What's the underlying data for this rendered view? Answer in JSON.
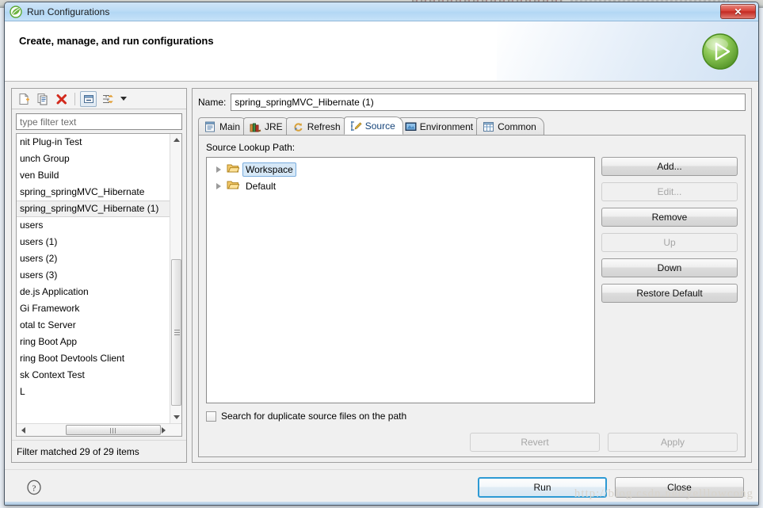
{
  "window": {
    "title": "Run Configurations",
    "title_icon": "spring-leaf-icon",
    "close_label": "✕"
  },
  "header": {
    "title": "Create, manage, and run configurations",
    "badge_icon": "run-play-icon"
  },
  "left_panel": {
    "toolbar": [
      {
        "name": "new-launch-configuration-icon",
        "label": "New launch configuration"
      },
      {
        "name": "duplicate-launch-configuration-icon",
        "label": "Duplicate"
      },
      {
        "name": "delete-launch-configuration-icon",
        "label": "Delete"
      },
      {
        "name": "collapse-all-icon",
        "label": "Collapse All"
      },
      {
        "name": "filter-launch-configurations-icon",
        "label": "Filter"
      }
    ],
    "filter": {
      "placeholder": "type filter text",
      "value": ""
    },
    "items": [
      {
        "label": "nit Plug-in Test",
        "selected": false
      },
      {
        "label": "unch Group",
        "selected": false
      },
      {
        "label": "ven Build",
        "selected": false
      },
      {
        "label": "spring_springMVC_Hibernate",
        "selected": false
      },
      {
        "label": "spring_springMVC_Hibernate (1)",
        "selected": true
      },
      {
        "label": "users",
        "selected": false
      },
      {
        "label": "users (1)",
        "selected": false
      },
      {
        "label": "users (2)",
        "selected": false
      },
      {
        "label": "users (3)",
        "selected": false
      },
      {
        "label": "de.js Application",
        "selected": false
      },
      {
        "label": "Gi Framework",
        "selected": false
      },
      {
        "label": "otal tc Server",
        "selected": false
      },
      {
        "label": "ring Boot App",
        "selected": false
      },
      {
        "label": "ring Boot Devtools Client",
        "selected": false
      },
      {
        "label": "sk Context Test",
        "selected": false
      },
      {
        "label": "L",
        "selected": false
      }
    ],
    "status": "Filter matched 29 of 29 items"
  },
  "right_panel": {
    "name_label": "Name:",
    "name_value": "spring_springMVC_Hibernate (1)",
    "tabs": [
      {
        "label": "Main",
        "icon": "main-tab-icon",
        "active": false
      },
      {
        "label": "JRE",
        "icon": "jre-tab-icon",
        "active": false
      },
      {
        "label": "Refresh",
        "icon": "refresh-tab-icon",
        "active": false
      },
      {
        "label": "Source",
        "icon": "source-tab-icon",
        "active": true
      },
      {
        "label": "Environment",
        "icon": "environment-tab-icon",
        "active": false
      },
      {
        "label": "Common",
        "icon": "common-tab-icon",
        "active": false
      }
    ],
    "source": {
      "lookup_label": "Source Lookup Path:",
      "entries": [
        {
          "label": "Workspace",
          "icon": "folder-icon",
          "selected": true
        },
        {
          "label": "Default",
          "icon": "folder-icon",
          "selected": false
        }
      ],
      "buttons": [
        {
          "label": "Add...",
          "enabled": true
        },
        {
          "label": "Edit...",
          "enabled": false
        },
        {
          "label": "Remove",
          "enabled": true
        },
        {
          "label": "Up",
          "enabled": false
        },
        {
          "label": "Down",
          "enabled": true
        },
        {
          "label": "Restore Default",
          "enabled": true
        }
      ],
      "duplicate_checkbox": {
        "label": "Search for duplicate source files on the path",
        "checked": false
      }
    },
    "revert_label": "Revert",
    "apply_label": "Apply"
  },
  "footer": {
    "help_icon": "help-question-icon",
    "run_label": "Run",
    "close_label": "Close",
    "watermark": "http://blog.csdn.net/yelllowcong"
  },
  "colors": {
    "titlebar": "#bcdcf6",
    "accent_blue": "#2e9ad4",
    "active_tab_text": "#17457a",
    "close_red": "#d9453b",
    "run_green": "#6cb33f"
  }
}
